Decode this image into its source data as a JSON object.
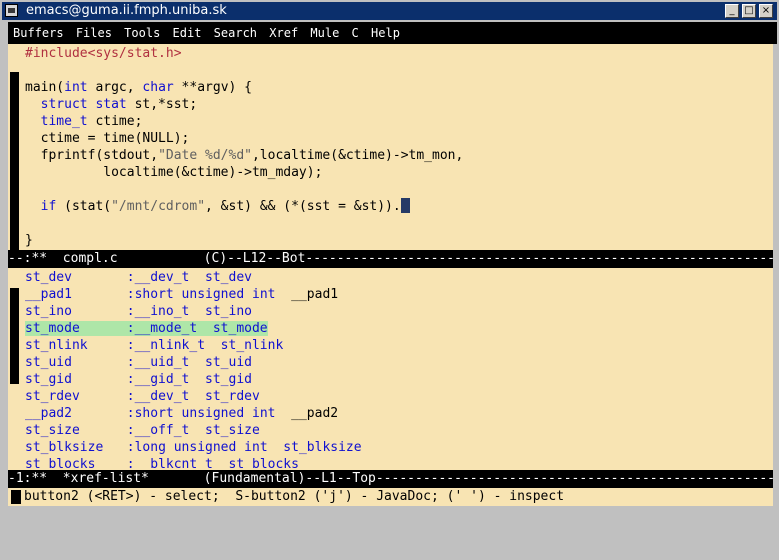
{
  "window": {
    "title": "emacs@guma.ii.fmph.uniba.sk"
  },
  "titlebar_buttons": {
    "minimize": "_",
    "maximize": "□",
    "close": "×"
  },
  "menu": [
    "Buffers",
    "Files",
    "Tools",
    "Edit",
    "Search",
    "Xref",
    "Mule",
    "C",
    "Help"
  ],
  "code_lines": [
    [
      {
        "t": "#include<sys/stat.h>",
        "c": "pre"
      }
    ],
    [],
    [
      {
        "t": "main(",
        "c": ""
      },
      {
        "t": "int",
        "c": "kw"
      },
      {
        "t": " argc, ",
        "c": ""
      },
      {
        "t": "char",
        "c": "kw"
      },
      {
        "t": " **argv) {",
        "c": ""
      }
    ],
    [
      {
        "t": "  ",
        "c": ""
      },
      {
        "t": "struct stat",
        "c": "kw"
      },
      {
        "t": " st,*sst;",
        "c": ""
      }
    ],
    [
      {
        "t": "  ",
        "c": ""
      },
      {
        "t": "time_t",
        "c": "kw"
      },
      {
        "t": " ctime;",
        "c": ""
      }
    ],
    [
      {
        "t": "  ctime = time(NULL);",
        "c": ""
      }
    ],
    [
      {
        "t": "  fprintf(stdout,",
        "c": ""
      },
      {
        "t": "\"Date %d/%d\"",
        "c": "str"
      },
      {
        "t": ",localtime(&ctime)->tm_mon,",
        "c": ""
      }
    ],
    [
      {
        "t": "          localtime(&ctime)->tm_mday);",
        "c": ""
      }
    ],
    [],
    [
      {
        "t": "  ",
        "c": ""
      },
      {
        "t": "if",
        "c": "kw"
      },
      {
        "t": " (stat(",
        "c": ""
      },
      {
        "t": "\"/mnt/cdrom\"",
        "c": "str"
      },
      {
        "t": ", &st) && (*(sst = &st)).",
        "c": ""
      }
    ],
    [],
    [
      {
        "t": "}",
        "c": ""
      }
    ]
  ],
  "modeline1": {
    "text": "--:**  compl.c           (C)--L12--Bot-----------------------------------------------------------------------------"
  },
  "xref_lines": [
    [
      {
        "t": "st_dev",
        "c": "kw"
      },
      {
        "t": "       :__dev_t  st_dev",
        "c": "kw"
      }
    ],
    [
      {
        "t": "__pad1",
        "c": "kw"
      },
      {
        "t": "       :",
        "c": "kw"
      },
      {
        "t": "short unsigned int",
        "c": "kw"
      },
      {
        "t": "  __pad1",
        "c": ""
      }
    ],
    [
      {
        "t": "st_ino",
        "c": "kw"
      },
      {
        "t": "       :__ino_t  st_ino",
        "c": "kw"
      }
    ],
    [
      {
        "t": "st_mode      :__mode_t  st_mode",
        "c": "kw sel"
      }
    ],
    [
      {
        "t": "st_nlink",
        "c": "kw"
      },
      {
        "t": "     :__nlink_t  st_nlink",
        "c": "kw"
      }
    ],
    [
      {
        "t": "st_uid",
        "c": "kw"
      },
      {
        "t": "       :__uid_t  st_uid",
        "c": "kw"
      }
    ],
    [
      {
        "t": "st_gid",
        "c": "kw"
      },
      {
        "t": "       :__gid_t  st_gid",
        "c": "kw"
      }
    ],
    [
      {
        "t": "st_rdev",
        "c": "kw"
      },
      {
        "t": "      :__dev_t  st_rdev",
        "c": "kw"
      }
    ],
    [
      {
        "t": "__pad2",
        "c": "kw"
      },
      {
        "t": "       :",
        "c": "kw"
      },
      {
        "t": "short unsigned int",
        "c": "kw"
      },
      {
        "t": "  __pad2",
        "c": ""
      }
    ],
    [
      {
        "t": "st_size",
        "c": "kw"
      },
      {
        "t": "      :__off_t  st_size",
        "c": "kw"
      }
    ],
    [
      {
        "t": "st_blksize",
        "c": "kw"
      },
      {
        "t": "   :",
        "c": "kw"
      },
      {
        "t": "long unsigned int",
        "c": "kw"
      },
      {
        "t": "  st_blksize",
        "c": "kw"
      }
    ],
    [
      {
        "t": "st_blocks",
        "c": "kw"
      },
      {
        "t": "    :__blkcnt_t  st_blocks",
        "c": "kw"
      }
    ]
  ],
  "modeline2": {
    "text": "-1:**  *xref-list*       (Fundamental)--L1--Top-------------------------------------------------------------------"
  },
  "echo": {
    "text": "button2 (<RET>) - select;  S-button2 ('j') - JavaDoc; (' ') - inspect"
  },
  "colors": {
    "buffer_bg": "#f8e4b3",
    "keyword": "#1010d0",
    "preprocessor": "#b03040",
    "string": "#606060",
    "highlight": "#aee6a8",
    "titlebar": "#0b2f6c"
  }
}
